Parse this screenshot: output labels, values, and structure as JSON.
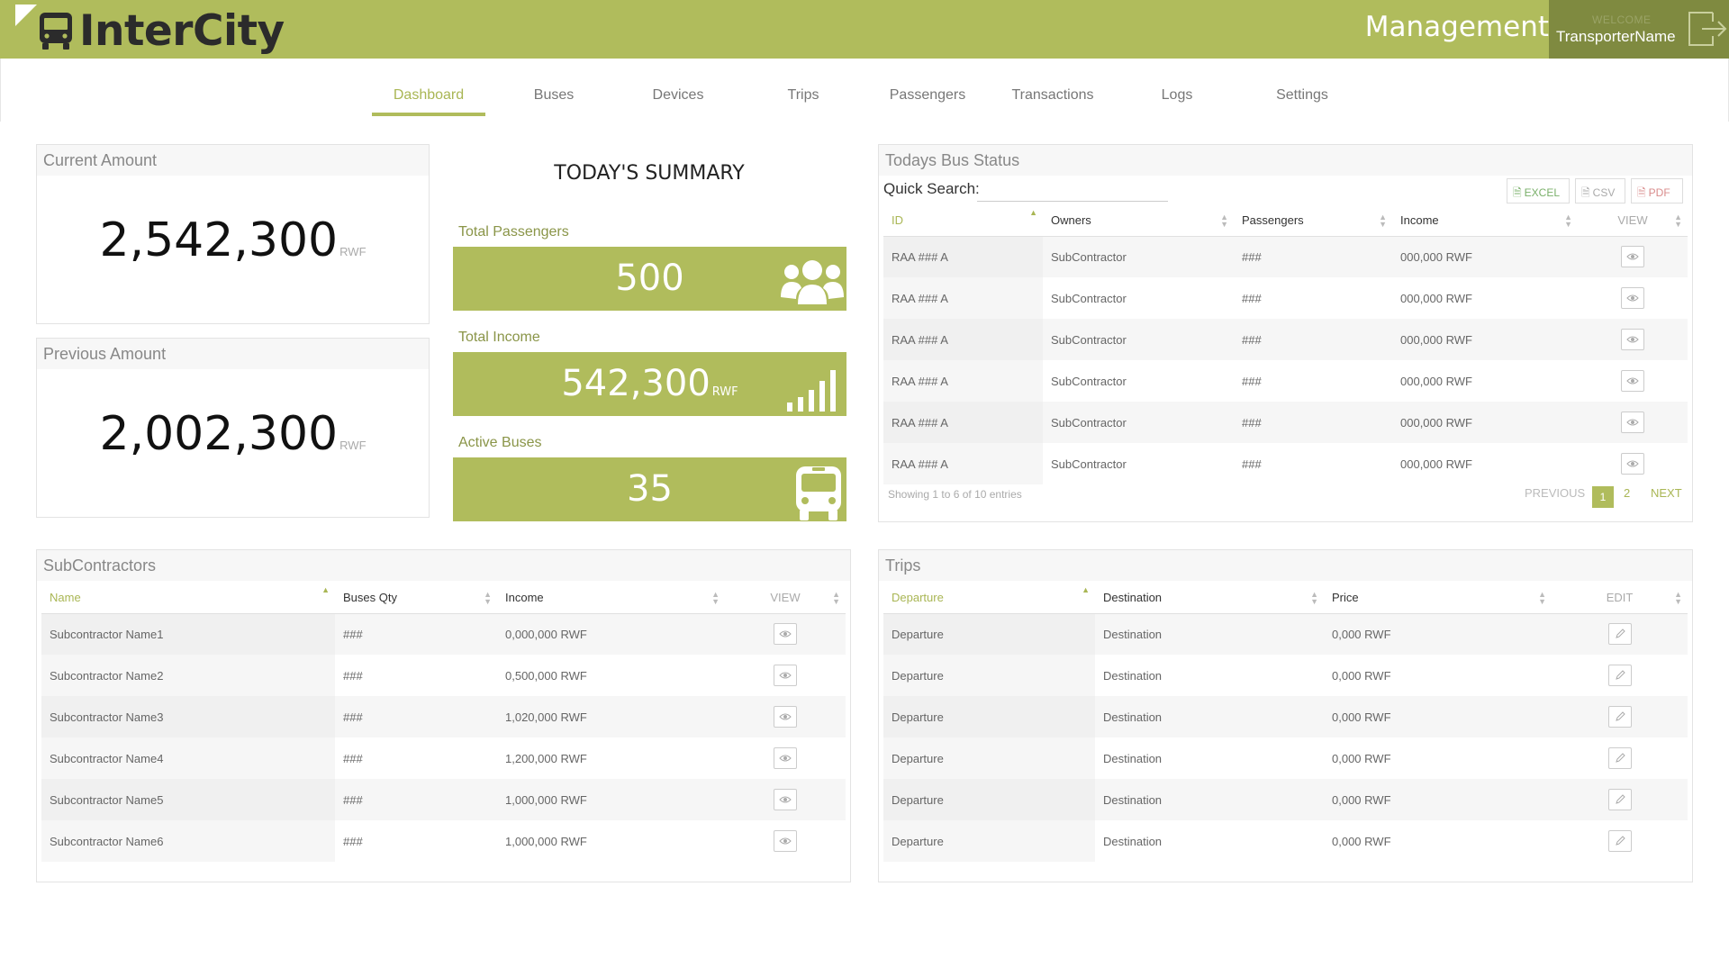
{
  "header": {
    "brand": "InterCity",
    "section": "Management",
    "welcome": "WELCOME",
    "user_name": "TransporterName",
    "bg_color": "#b0bc5c"
  },
  "nav": {
    "items": [
      "Dashboard",
      "Buses",
      "Devices",
      "Trips",
      "Passengers",
      "Transactions",
      "Logs",
      "Settings"
    ],
    "active": "Dashboard"
  },
  "current_amount": {
    "title": "Current Amount",
    "value": "2,542,300",
    "unit": "RWF"
  },
  "previous_amount": {
    "title": "Previous Amount",
    "value": "2,002,300",
    "unit": "RWF"
  },
  "summary": {
    "title": "TODAY'S SUMMARY",
    "passengers_label": "Total Passengers",
    "passengers_value": "500",
    "income_label": "Total Income",
    "income_value": "542,300",
    "income_unit": "RWF",
    "buses_label": "Active Buses",
    "buses_value": "35"
  },
  "bus_status": {
    "title": "Todays Bus Status",
    "quick_search_label": "Quick Search:",
    "quick_search_value": "",
    "export_excel": "EXCEL",
    "export_csv": "CSV",
    "export_pdf": "PDF",
    "columns": [
      "ID",
      "Owners",
      "Passengers",
      "Income",
      "VIEW"
    ],
    "rows": [
      [
        "RAA ### A",
        "SubContractor",
        "###",
        "000,000 RWF"
      ],
      [
        "RAA ### A",
        "SubContractor",
        "###",
        "000,000 RWF"
      ],
      [
        "RAA ### A",
        "SubContractor",
        "###",
        "000,000 RWF"
      ],
      [
        "RAA ### A",
        "SubContractor",
        "###",
        "000,000 RWF"
      ],
      [
        "RAA ### A",
        "SubContractor",
        "###",
        "000,000 RWF"
      ],
      [
        "RAA ### A",
        "SubContractor",
        "###",
        "000,000 RWF"
      ]
    ],
    "showing": "Showing 1 to 6 of 10 entries",
    "pager": {
      "prev": "PREVIOUS",
      "page1": "1",
      "page2": "2",
      "next": "NEXT"
    }
  },
  "subcontractors": {
    "title": "SubContractors",
    "columns": [
      "Name",
      "Buses Qty",
      "Income",
      "VIEW"
    ],
    "rows": [
      [
        "Subcontractor Name1",
        "###",
        "0,000,000 RWF"
      ],
      [
        "Subcontractor Name2",
        "###",
        "0,500,000 RWF"
      ],
      [
        "Subcontractor Name3",
        "###",
        "1,020,000 RWF"
      ],
      [
        "Subcontractor Name4",
        "###",
        "1,200,000 RWF"
      ],
      [
        "Subcontractor Name5",
        "###",
        "1,000,000 RWF"
      ],
      [
        "Subcontractor Name6",
        "###",
        "1,000,000 RWF"
      ]
    ]
  },
  "trips": {
    "title": "Trips",
    "columns": [
      "Departure",
      "Destination",
      "Price",
      "EDIT"
    ],
    "rows": [
      [
        "Departure",
        "Destination",
        "0,000 RWF"
      ],
      [
        "Departure",
        "Destination",
        "0,000 RWF"
      ],
      [
        "Departure",
        "Destination",
        "0,000 RWF"
      ],
      [
        "Departure",
        "Destination",
        "0,000 RWF"
      ],
      [
        "Departure",
        "Destination",
        "0,000 RWF"
      ],
      [
        "Departure",
        "Destination",
        "0,000 RWF"
      ]
    ]
  }
}
